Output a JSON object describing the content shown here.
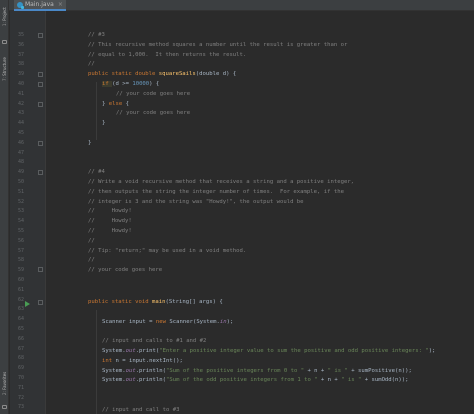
{
  "window": {
    "tab_label": "Main.java",
    "tab_close": "×"
  },
  "toolwindows": {
    "project_num": "1:",
    "project_label": "Project",
    "structure_num": "7:",
    "structure_label": "Structure",
    "favorites_num": "2:",
    "favorites_label": "Favorites"
  },
  "colors": {
    "background": "#2b2b2b",
    "comment": "#808080",
    "keyword": "#cc7832",
    "method": "#ffc66d",
    "number": "#6897bb",
    "string": "#6a8759",
    "static_field": "#9876aa",
    "tab_underline": "#4a88c7"
  },
  "code": {
    "l35": "// #3",
    "l36": "// This recursive method squares a number until the result is greater than or",
    "l37": "// equal to 1,000.  It then returns the result.",
    "l38": "//",
    "l39_kw": "public static double ",
    "l39_name": "squareSails",
    "l39_rest": "(double d) {",
    "l40_kw": "if ",
    "l40_a": "(d >= ",
    "l40_num": "10000",
    "l40_b": ") {",
    "l41": "// your code goes here",
    "l42_a": "} ",
    "l42_kw": "else ",
    "l42_b": "{",
    "l43": "// your code goes here",
    "l44": "}",
    "l46": "}",
    "l50": "// #4",
    "l51": "// Write a void recursive method that receives a string and a positive integer,",
    "l52": "// then outputs the string the integer number of times.  For example, if the",
    "l53": "// integer is 3 and the string was \"Howdy!\", the output would be",
    "l54": "//     Howdy!",
    "l55": "//     Howdy!",
    "l56": "//     Howdy!",
    "l57": "//",
    "l58": "// Tip: \"return;\" may be used in a void method.",
    "l59": "//",
    "l60": "// your code goes here",
    "l64_kw": "public static void ",
    "l64_name": "main",
    "l64_rest": "(String[] args) {",
    "l66_a": "Scanner input = ",
    "l66_kw": "new ",
    "l66_b": "Scanner(System.",
    "l66_st": "in",
    "l66_c": ");",
    "l68": "// input and calls to #1 and #2",
    "l69_a": "System.",
    "l69_st": "out",
    "l69_b": ".print(",
    "l69_s": "\"Enter a positive integer value to sum the positive and odd positive integers: \"",
    "l69_c": ");",
    "l70_kw": "int ",
    "l70_a": "n = input.nextInt();",
    "l71_a": "System.",
    "l71_st": "out",
    "l71_b": ".println(",
    "l71_s1": "\"Sum of the positive integers from 0 to \"",
    "l71_c": " + n + ",
    "l71_s2": "\" is \"",
    "l71_d": " + sumPositive(n));",
    "l72_a": "System.",
    "l72_st": "out",
    "l72_b": ".println(",
    "l72_s1": "\"Sum of the odd positive integers from 1 to \"",
    "l72_c": " + n + ",
    "l72_s2": "\" is \"",
    "l72_d": " + sumOdd(n));",
    "l75": "// input and call to #3"
  },
  "line_numbers": [
    "35",
    "36",
    "37",
    "38",
    "39",
    "40",
    "41",
    "42",
    "43",
    "44",
    "45",
    "46",
    "47",
    "48",
    "49",
    "50",
    "51",
    "52",
    "53",
    "54",
    "55",
    "56",
    "57",
    "58",
    "59",
    "60",
    "61",
    "62",
    "63",
    "64",
    "65",
    "66",
    "67",
    "68",
    "69",
    "70",
    "71",
    "72",
    "73",
    "74",
    "75"
  ]
}
